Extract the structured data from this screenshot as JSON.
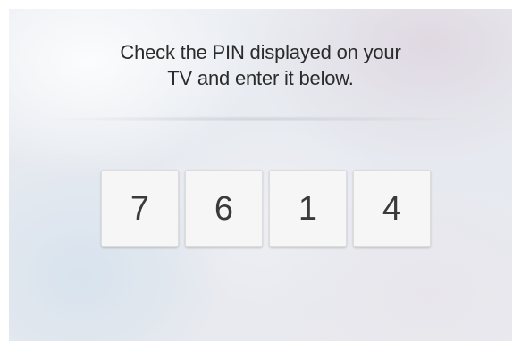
{
  "prompt": {
    "line1": "Check the PIN displayed on your",
    "line2": "TV and enter it below."
  },
  "pin": {
    "digits": [
      "7",
      "6",
      "1",
      "4"
    ]
  }
}
